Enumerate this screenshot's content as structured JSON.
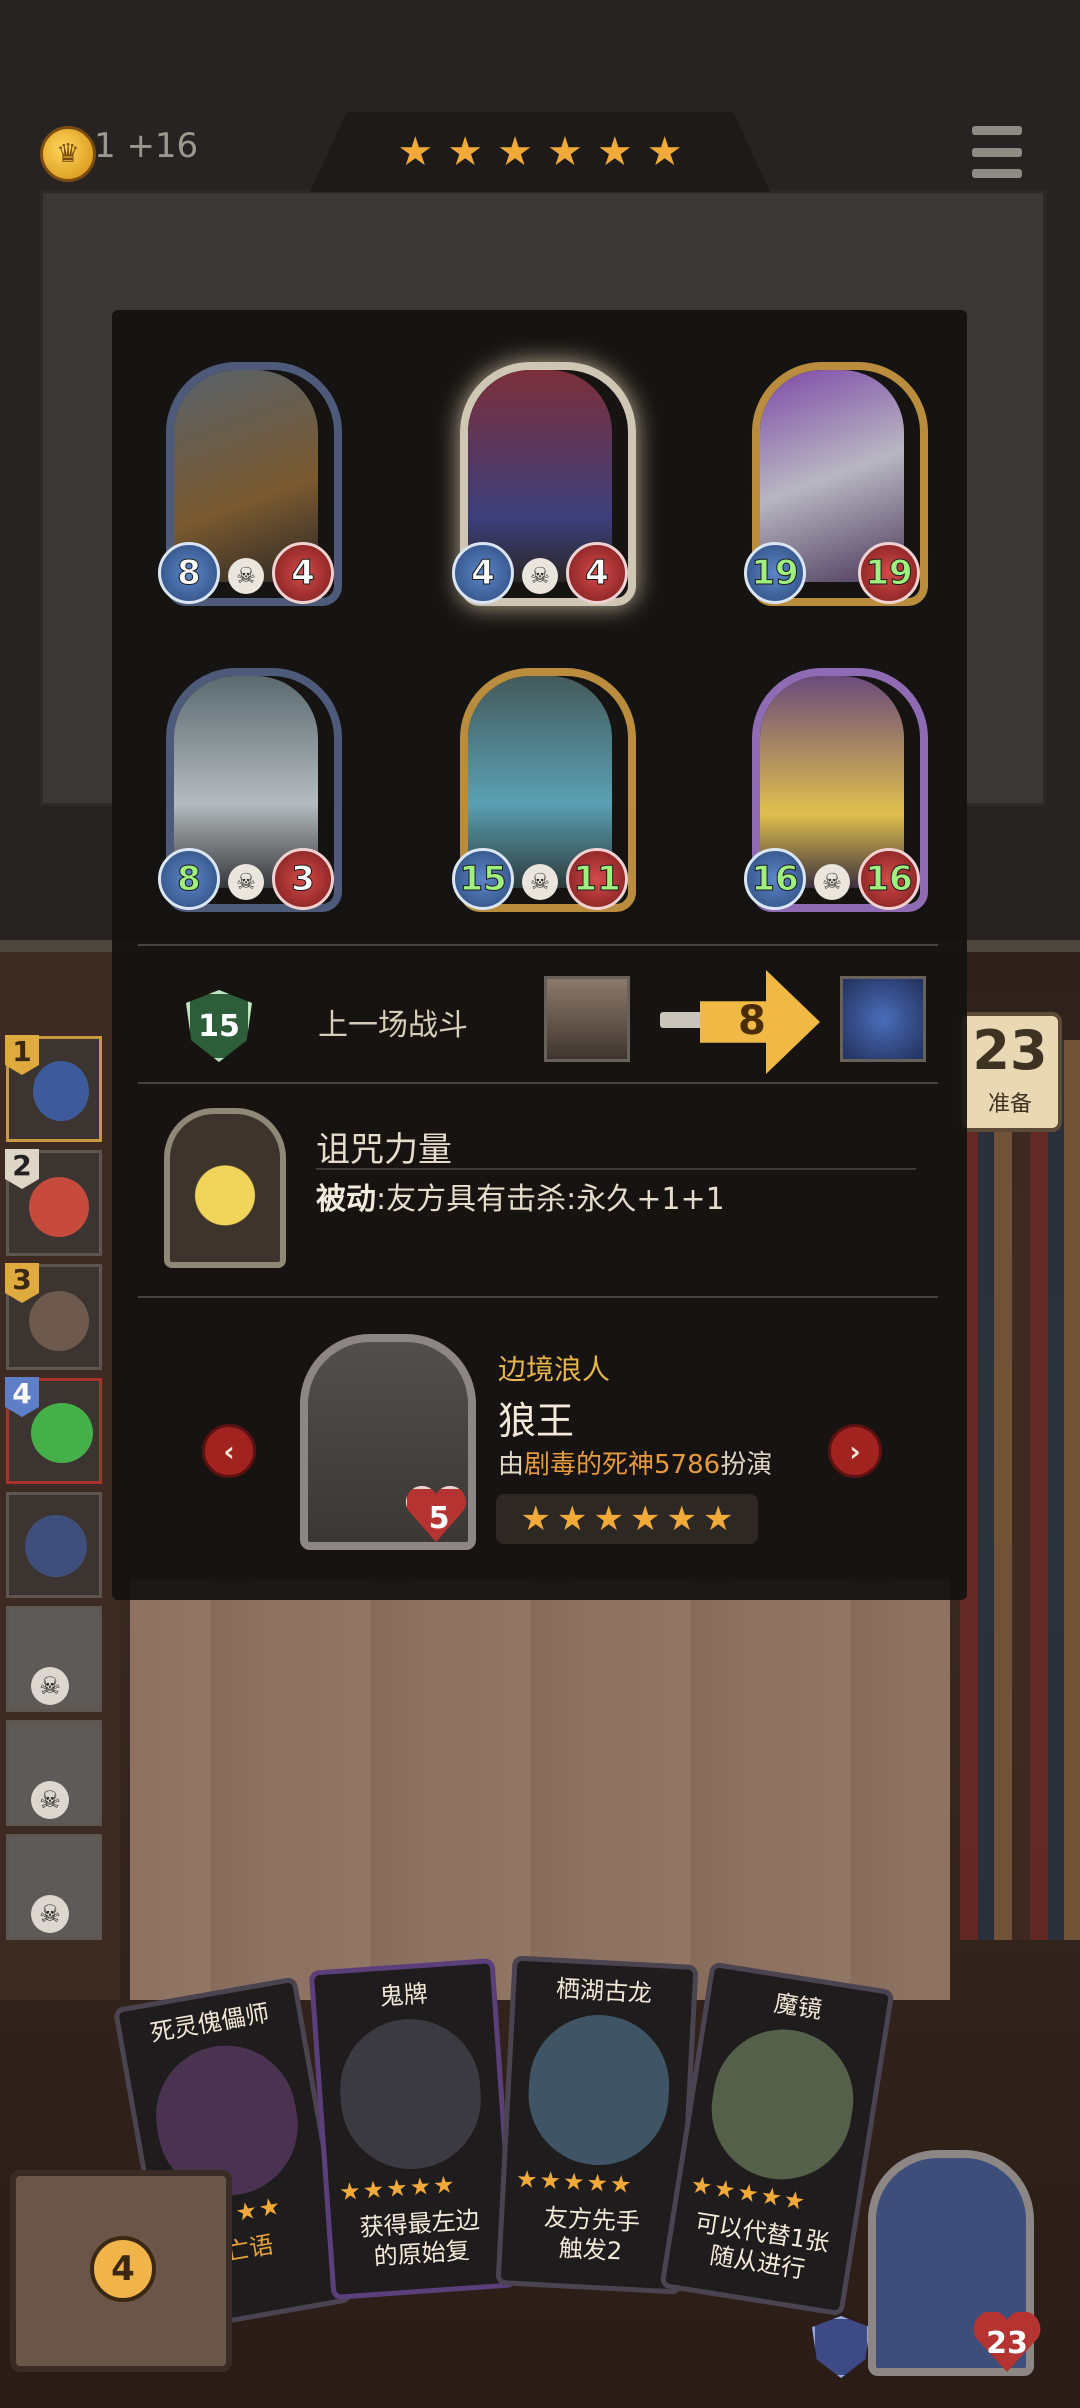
{
  "top_bar": {
    "coin_text": "1 +16",
    "stars": [
      "★",
      "★",
      "★",
      "★",
      "★",
      "★"
    ]
  },
  "panel": {
    "cards": [
      {
        "attack": "8",
        "health": "4",
        "frame": "blue",
        "icon": "engine-relic"
      },
      {
        "attack": "4",
        "health": "4",
        "frame": "glow",
        "icon": "clown-character"
      },
      {
        "attack": "19",
        "health": "19",
        "frame": "gold",
        "icon": "cannon-weapon"
      },
      {
        "attack": "8",
        "health": "3",
        "frame": "blue",
        "icon": "robot-character"
      },
      {
        "attack": "15",
        "health": "11",
        "frame": "gold",
        "icon": "rabbit-character"
      },
      {
        "attack": "16",
        "health": "16",
        "frame": "purple",
        "icon": "cheese-robot"
      }
    ],
    "last_battle": {
      "level": "15",
      "label": "上一场战斗",
      "damage": "8"
    },
    "relic": {
      "name": "诅咒力量",
      "desc_bold": "被动",
      "desc_rest": ":友方具有击杀:永久+1+1"
    },
    "hero": {
      "class": "边境浪人",
      "name": "狼王",
      "player_prefix": "由",
      "player_name": "剧毒的死神5786",
      "player_suffix": "扮演",
      "health": "5",
      "stars": [
        "★",
        "★",
        "★",
        "★",
        "★",
        "★"
      ]
    }
  },
  "prepare": {
    "number": "23",
    "label": "准备"
  },
  "roster": [
    {
      "rank": "1",
      "state": "active"
    },
    {
      "rank": "2",
      "state": "alive"
    },
    {
      "rank": "3",
      "state": "alive"
    },
    {
      "rank": "4",
      "state": "alive"
    },
    {
      "rank": "",
      "state": "alive"
    },
    {
      "rank": "",
      "state": "dead"
    },
    {
      "rank": "",
      "state": "dead"
    },
    {
      "rank": "",
      "state": "dead"
    }
  ],
  "hand": [
    {
      "title": "死灵傀儡师",
      "desc_line1": "亡语",
      "desc_line2": ""
    },
    {
      "title": "鬼牌",
      "desc_line1": "获得最左边",
      "desc_line2": "的原始复"
    },
    {
      "title": "栖湖古龙",
      "desc_line1": "友方先手",
      "desc_line2": "触发2"
    },
    {
      "title": "魔镜",
      "desc_line1": "可以代替1张",
      "desc_line2": "随从进行"
    }
  ],
  "bottom": {
    "chest_count": "4",
    "hero_health": "23"
  },
  "colors": {
    "accent_gold": "#f1a93a",
    "danger_red": "#a0231f"
  }
}
